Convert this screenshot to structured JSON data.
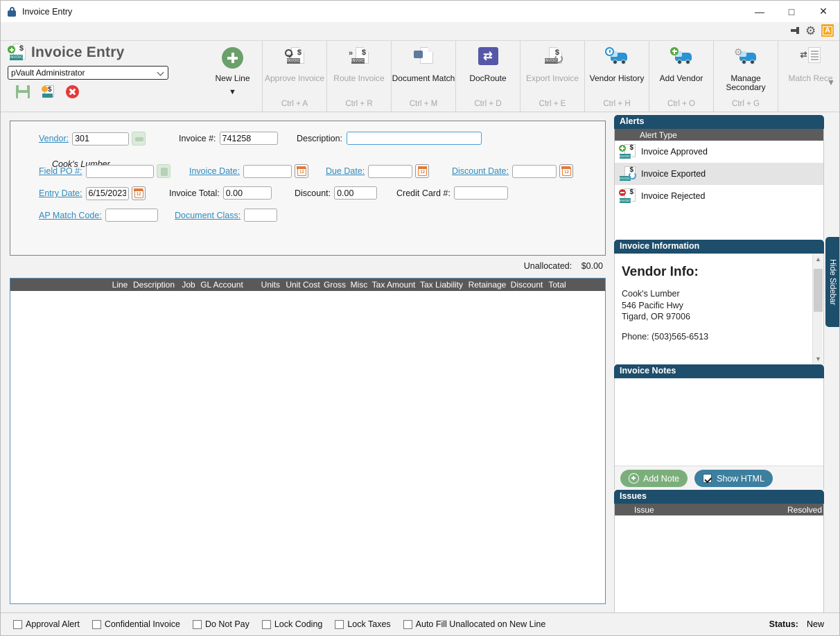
{
  "window": {
    "title": "Invoice Entry",
    "minimize": "—",
    "maximize": "□",
    "close": "✕"
  },
  "subbar": {
    "pin_icon": "pin-icon",
    "gear_icon": "gear-icon",
    "app_icon": "A"
  },
  "ribbon": {
    "title": "Invoice Entry",
    "user_select": "pVault Administrator",
    "quick_actions": [
      "save-icon",
      "save-invoice-icon",
      "cancel-icon"
    ],
    "items": [
      {
        "label": "New Line",
        "shortcut": "",
        "disabled": false,
        "icon": "plus-circle-icon",
        "has_caret": true
      },
      {
        "label": "Approve Invoice",
        "shortcut": "Ctrl + A",
        "disabled": true,
        "icon": "approve-invoice-icon"
      },
      {
        "label": "Route Invoice",
        "shortcut": "Ctrl + R",
        "disabled": true,
        "icon": "route-invoice-icon"
      },
      {
        "label": "Document Match",
        "shortcut": "Ctrl + M",
        "disabled": false,
        "icon": "document-match-icon"
      },
      {
        "label": "DocRoute",
        "shortcut": "Ctrl + D",
        "disabled": false,
        "icon": "docroute-icon"
      },
      {
        "label": "Export Invoice",
        "shortcut": "Ctrl + E",
        "disabled": true,
        "icon": "export-invoice-icon"
      },
      {
        "label": "Vendor History",
        "shortcut": "Ctrl + H",
        "disabled": false,
        "icon": "vendor-history-icon"
      },
      {
        "label": "Add Vendor",
        "shortcut": "Ctrl + O",
        "disabled": false,
        "icon": "add-vendor-icon"
      },
      {
        "label": "Manage Secondary",
        "shortcut": "Ctrl + G",
        "disabled": false,
        "icon": "manage-secondary-icon"
      },
      {
        "label": "Match Rece",
        "shortcut": "",
        "disabled": true,
        "icon": "match-receipt-icon"
      }
    ],
    "overflow": "▼"
  },
  "form": {
    "vendor_label": "Vendor:",
    "vendor_value": "301",
    "vendor_name": "Cook's Lumber",
    "invoice_num_label": "Invoice #:",
    "invoice_num_value": "741258",
    "description_label": "Description:",
    "description_value": "",
    "field_po_label": "Field PO #:",
    "field_po_value": "",
    "invoice_date_label": "Invoice Date:",
    "invoice_date_value": "",
    "due_date_label": "Due Date:",
    "due_date_value": "",
    "discount_date_label": "Discount Date:",
    "discount_date_value": "",
    "entry_date_label": "Entry Date:",
    "entry_date_value": "6/15/2023",
    "invoice_total_label": "Invoice Total:",
    "invoice_total_value": "0.00",
    "discount_label": "Discount:",
    "discount_value": "0.00",
    "credit_card_label": "Credit Card #:",
    "credit_card_value": "",
    "ap_match_code_label": "AP Match Code:",
    "ap_match_code_value": "",
    "document_class_label": "Document Class:",
    "document_class_value": ""
  },
  "unallocated": {
    "label": "Unallocated:",
    "amount": "$0.00"
  },
  "grid": {
    "columns": [
      "Line",
      "Description",
      "Job",
      "GL Account",
      "Units",
      "Unit Cost",
      "Gross",
      "Misc",
      "Tax Amount",
      "Tax Liability",
      "Retainage",
      "Discount",
      "Total"
    ],
    "rows": []
  },
  "sidebar": {
    "alerts": {
      "title": "Alerts",
      "column": "Alert Type",
      "rows": [
        {
          "label": "Invoice Approved",
          "selected": false,
          "icon": "invoice-approved-icon"
        },
        {
          "label": "Invoice Exported",
          "selected": true,
          "icon": "invoice-exported-icon"
        },
        {
          "label": "Invoice Rejected",
          "selected": false,
          "icon": "invoice-rejected-icon"
        }
      ]
    },
    "invoice_information": {
      "title": "Invoice Information",
      "heading": "Vendor Info:",
      "vendor_name": "Cook's Lumber",
      "address_line": "546 Pacific Hwy",
      "city_state_zip": "Tigard, OR 97006",
      "phone": "Phone: (503)565-6513"
    },
    "invoice_notes": {
      "title": "Invoice Notes",
      "add_note_label": "Add Note",
      "show_html_label": "Show HTML",
      "show_html_checked": true,
      "content": ""
    },
    "issues": {
      "title": "Issues",
      "columns": [
        "Issue",
        "Resolved"
      ],
      "rows": []
    },
    "hide_sidebar_label": "Hide Sidebar"
  },
  "statusbar": {
    "checkboxes": [
      {
        "label": "Approval Alert",
        "checked": false
      },
      {
        "label": "Confidential Invoice",
        "checked": false
      },
      {
        "label": "Do Not Pay",
        "checked": false
      },
      {
        "label": "Lock Coding",
        "checked": false
      },
      {
        "label": "Lock Taxes",
        "checked": false
      },
      {
        "label": "Auto Fill Unallocated on New Line",
        "checked": false
      }
    ],
    "status_label": "Status:",
    "status_value": "New"
  },
  "colors": {
    "panel_header": "#1d4e6b",
    "grid_header": "#595959",
    "link": "#2e8bbf",
    "accent_green": "#7cae7c",
    "accent_blue": "#3d7f9e",
    "calendar_orange": "#e07b39"
  }
}
